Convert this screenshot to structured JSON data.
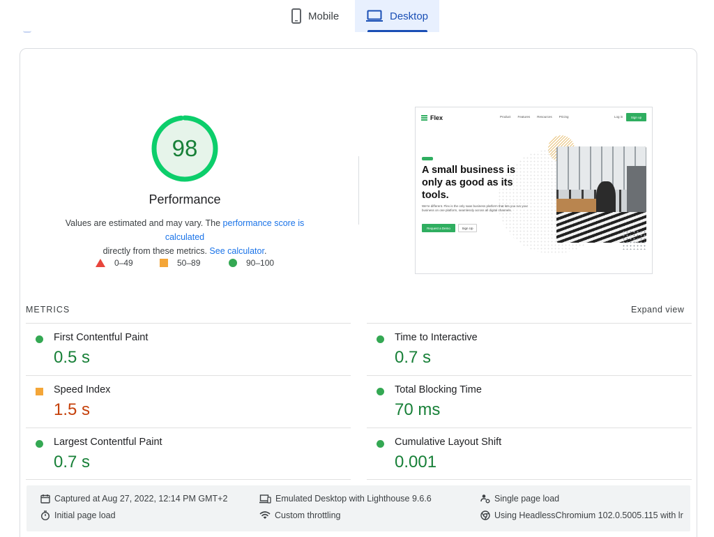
{
  "tabs": [
    {
      "label": "Mobile",
      "icon": "smartphone-icon",
      "active": false
    },
    {
      "label": "Desktop",
      "icon": "laptop-icon",
      "active": true
    }
  ],
  "score": {
    "value": "98",
    "value_fraction": 0.98,
    "title": "Performance",
    "desc_text_1": "Values are estimated and may vary. The ",
    "desc_link_1": "performance score is calculated",
    "desc_text_2": " directly from these metrics. ",
    "desc_link_2": "See calculator",
    "desc_text_3": ".",
    "color": "#0cce6b"
  },
  "legend": [
    {
      "range": "0–49",
      "shape": "triangle",
      "color": "#e8453c"
    },
    {
      "range": "50–89",
      "shape": "square",
      "color": "#f4a638"
    },
    {
      "range": "90–100",
      "shape": "circle",
      "color": "#34a853"
    }
  ],
  "screenshot": {
    "brand": "Flex",
    "nav_links": [
      "Product",
      "Features",
      "Resources",
      "Pricing"
    ],
    "login": "Log in",
    "signup": "Sign up",
    "headline": "A small business is only as good as its tools.",
    "body": "We're different. Flex is the only saas business platform that lets you run your business on one platform, seamlessly across all digital channels.",
    "cta_primary": "Request a Demo",
    "cta_secondary": "Sign Up"
  },
  "metrics_section": {
    "label": "METRICS",
    "expand": "Expand view"
  },
  "metrics": [
    {
      "name": "First Contentful Paint",
      "value": "0.5 s",
      "status": "good"
    },
    {
      "name": "Time to Interactive",
      "value": "0.7 s",
      "status": "good"
    },
    {
      "name": "Speed Index",
      "value": "1.5 s",
      "status": "average"
    },
    {
      "name": "Total Blocking Time",
      "value": "70 ms",
      "status": "good"
    },
    {
      "name": "Largest Contentful Paint",
      "value": "0.7 s",
      "status": "good"
    },
    {
      "name": "Cumulative Layout Shift",
      "value": "0.001",
      "status": "good"
    }
  ],
  "footer": {
    "captured": "Captured at Aug 27, 2022, 12:14 PM GMT+2",
    "emulated": "Emulated Desktop with Lighthouse 9.6.6",
    "single_load": "Single page load",
    "initial_load": "Initial page load",
    "throttling": "Custom throttling",
    "browser": "Using HeadlessChromium 102.0.5005.115 with lr"
  }
}
